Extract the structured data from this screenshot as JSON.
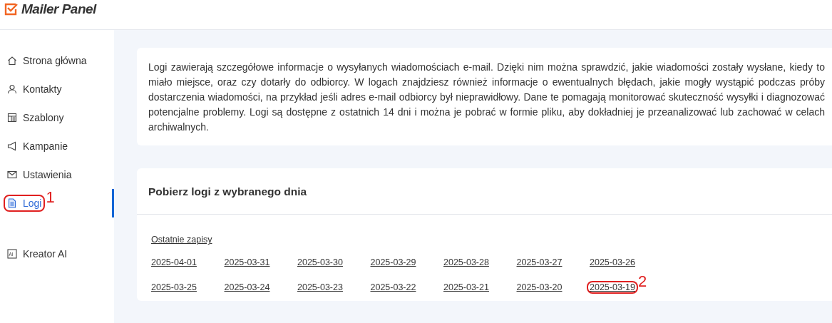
{
  "logo": {
    "text": "Mailer Panel"
  },
  "sidebar": {
    "items": [
      {
        "label": "Strona główna",
        "kind": "home",
        "selected": false
      },
      {
        "label": "Kontakty",
        "kind": "user",
        "selected": false
      },
      {
        "label": "Szablony",
        "kind": "template",
        "selected": false
      },
      {
        "label": "Kampanie",
        "kind": "megaphone",
        "selected": false
      },
      {
        "label": "Ustawienia",
        "kind": "mail",
        "selected": false
      },
      {
        "label": "Logi",
        "kind": "document",
        "selected": true,
        "callout": "1"
      }
    ],
    "bottom_items": [
      {
        "label": "Kreator AI",
        "kind": "ai",
        "icon_text": "AI",
        "selected": false
      }
    ]
  },
  "info": {
    "text": "Logi zawierają szczegółowe informacje o wysyłanych wiadomościach e-mail. Dzięki nim można sprawdzić, jakie wiadomości zostały wysłane, kiedy to miało miejsce, oraz czy dotarły do odbiorcy. W logach znajdziesz również informacje o ewentualnych błędach, jakie mogły wystąpić podczas próby dostarczenia wiadomości, na przykład jeśli adres e-mail odbiorcy był nieprawidłowy. Dane te pomagają monitorować skuteczność wysyłki i diagnozować potencjalne problemy. Logi są dostępne z ostatnich 14 dni i można je pobrać w formie pliku, aby dokładniej je przeanalizować lub zachować w celach archiwalnych."
  },
  "logs": {
    "title": "Pobierz logi z wybranego dnia",
    "recent": "Ostatnie zapisy",
    "dates": [
      {
        "label": "2025-04-01"
      },
      {
        "label": "2025-03-31"
      },
      {
        "label": "2025-03-30"
      },
      {
        "label": "2025-03-29"
      },
      {
        "label": "2025-03-28"
      },
      {
        "label": "2025-03-27"
      },
      {
        "label": "2025-03-26"
      },
      {
        "label": "2025-03-25"
      },
      {
        "label": "2025-03-24"
      },
      {
        "label": "2025-03-23"
      },
      {
        "label": "2025-03-22"
      },
      {
        "label": "2025-03-21"
      },
      {
        "label": "2025-03-20"
      },
      {
        "label": "2025-03-19",
        "callout": "2"
      }
    ]
  }
}
